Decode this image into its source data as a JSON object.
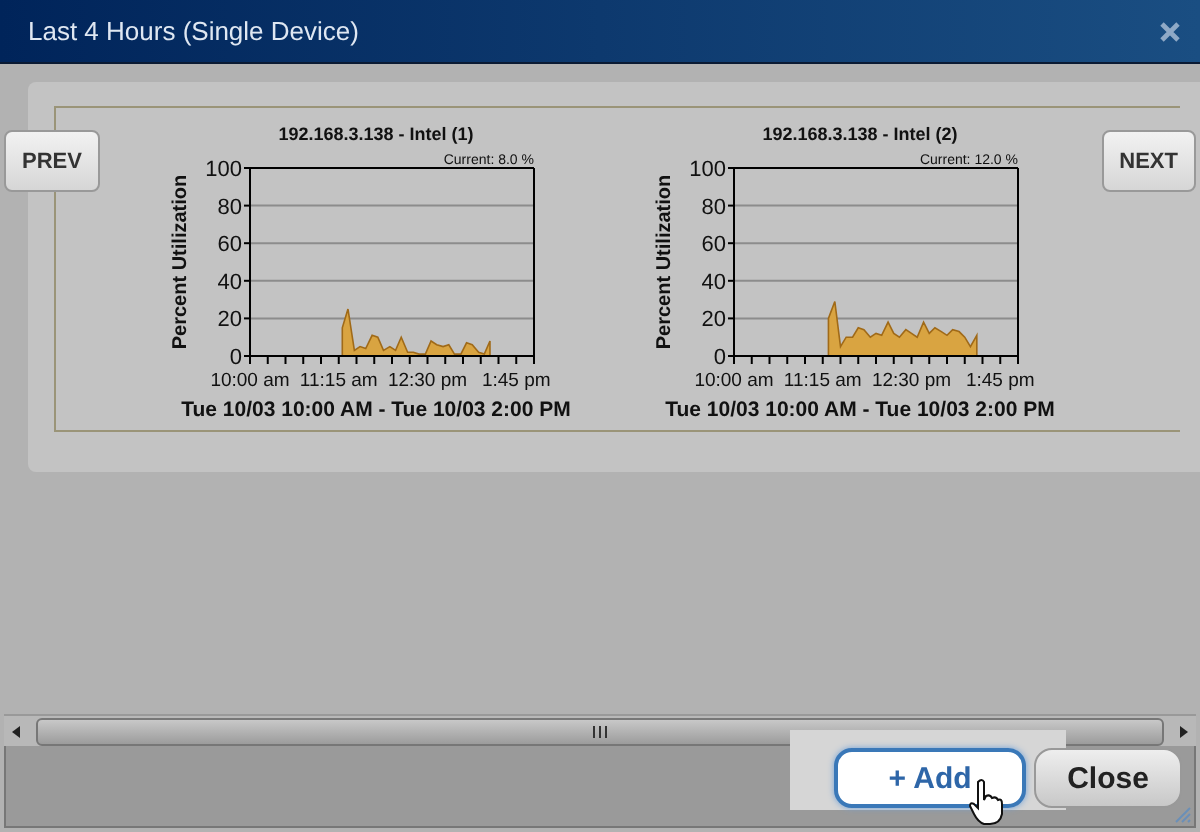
{
  "dialog": {
    "title": "Last 4 Hours (Single Device)"
  },
  "nav": {
    "prev": "PREV",
    "next": "NEXT"
  },
  "charts": [
    {
      "chart_data": {
        "type": "area",
        "title": "192.168.3.138 - Intel (1)",
        "xlabel": "Tue 10/03 10:00 AM - Tue 10/03 2:00 PM",
        "ylabel": "Percent Utilization",
        "x": [
          11.3,
          11.38,
          11.47,
          11.55,
          11.63,
          11.72,
          11.8,
          11.88,
          11.97,
          12.05,
          12.13,
          12.22,
          12.3,
          12.38,
          12.47,
          12.55,
          12.63,
          12.72,
          12.8,
          12.88,
          12.97,
          13.05,
          13.13,
          13.22,
          13.3,
          13.38
        ],
        "series": [
          {
            "color": "#d9a441",
            "values": [
              15,
              25,
              3,
              5,
              4,
              11,
              10,
              3,
              5,
              3,
              10,
              2,
              2,
              1,
              1,
              8,
              6,
              5,
              6,
              1,
              1,
              7,
              6,
              2,
              1,
              8
            ]
          }
        ],
        "xlim": [
          10,
          14
        ],
        "ylim": [
          0,
          100
        ],
        "xticks": [
          {
            "value": 10,
            "label": "10:00 am"
          },
          {
            "value": 11.25,
            "label": "11:15 am"
          },
          {
            "value": 12.5,
            "label": "12:30 pm"
          },
          {
            "value": 13.75,
            "label": "1:45 pm"
          }
        ],
        "yticks": [
          0,
          20,
          40,
          60,
          80,
          100
        ],
        "grid": true,
        "annotations": [
          "Current: 8.0 %"
        ]
      }
    },
    {
      "chart_data": {
        "type": "area",
        "title": "192.168.3.138 - Intel (2)",
        "xlabel": "Tue 10/03 10:00 AM - Tue 10/03 2:00 PM",
        "ylabel": "Percent Utilization",
        "x": [
          11.33,
          11.42,
          11.5,
          11.58,
          11.67,
          11.75,
          11.83,
          11.92,
          12.0,
          12.08,
          12.17,
          12.25,
          12.33,
          12.42,
          12.5,
          12.58,
          12.67,
          12.75,
          12.83,
          12.92,
          13.0,
          13.08,
          13.17,
          13.25,
          13.33,
          13.42
        ],
        "series": [
          {
            "color": "#d9a441",
            "values": [
              20,
              29,
              5,
              10,
              10,
              15,
              14,
              10,
              12,
              11,
              18,
              12,
              10,
              14,
              12,
              10,
              18,
              12,
              15,
              13,
              11,
              14,
              13,
              10,
              5,
              11
            ]
          }
        ],
        "xlim": [
          10,
          14
        ],
        "ylim": [
          0,
          100
        ],
        "xticks": [
          {
            "value": 10,
            "label": "10:00 am"
          },
          {
            "value": 11.25,
            "label": "11:15 am"
          },
          {
            "value": 12.5,
            "label": "12:30 pm"
          },
          {
            "value": 13.75,
            "label": "1:45 pm"
          }
        ],
        "yticks": [
          0,
          20,
          40,
          60,
          80,
          100
        ],
        "grid": true,
        "annotations": [
          "Current: 12.0 %"
        ]
      }
    }
  ],
  "buttons": [
    {
      "label": "+ Add",
      "kind": "primary"
    },
    {
      "label": "Close",
      "kind": "secondary"
    }
  ]
}
